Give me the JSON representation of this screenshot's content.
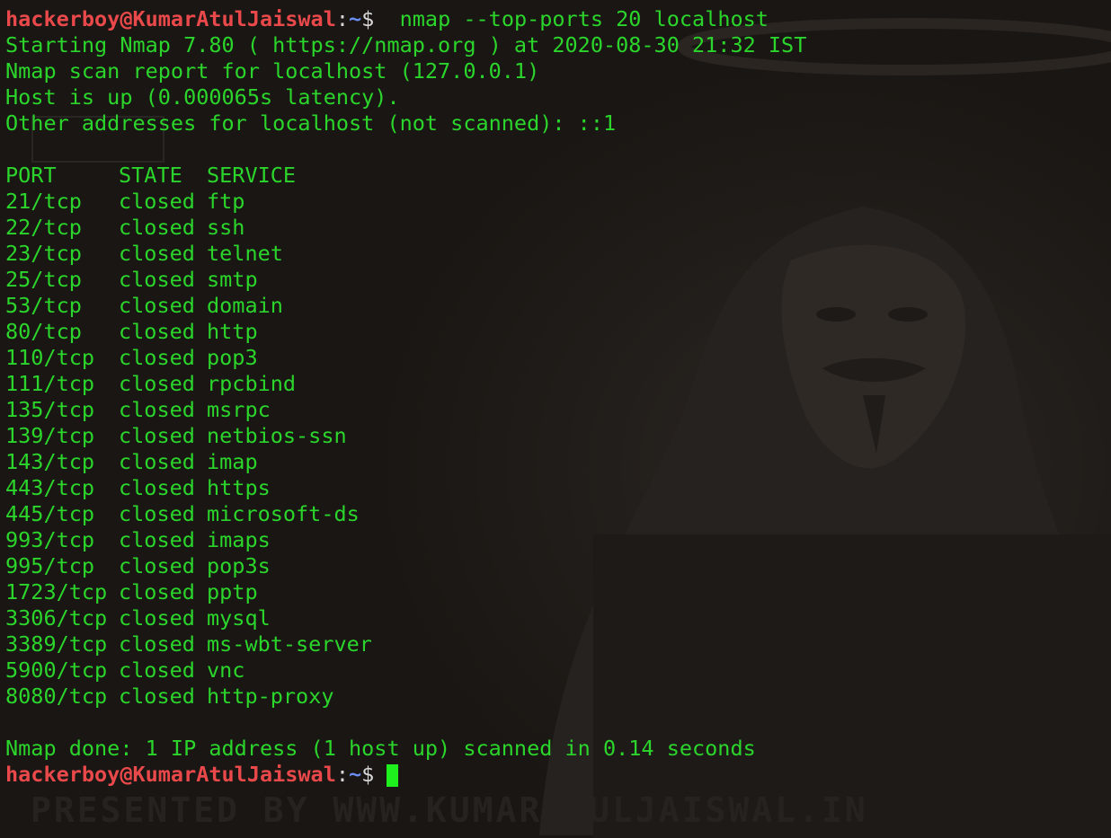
{
  "watermark": "PRESENTED BY WWW.KUMARATULJAISWAL.IN",
  "prompt": {
    "user_host": "hackerboy@KumarAtulJaiswal",
    "separator": ":",
    "path": "~",
    "symbol": "$"
  },
  "command": " nmap --top-ports 20 localhost",
  "header_lines": [
    "Starting Nmap 7.80 ( https://nmap.org ) at 2020-08-30 21:32 IST",
    "Nmap scan report for localhost (127.0.0.1)",
    "Host is up (0.000065s latency).",
    "Other addresses for localhost (not scanned): ::1"
  ],
  "table": {
    "headers": [
      "PORT",
      "STATE",
      "SERVICE"
    ],
    "rows": [
      [
        "21/tcp",
        "closed",
        "ftp"
      ],
      [
        "22/tcp",
        "closed",
        "ssh"
      ],
      [
        "23/tcp",
        "closed",
        "telnet"
      ],
      [
        "25/tcp",
        "closed",
        "smtp"
      ],
      [
        "53/tcp",
        "closed",
        "domain"
      ],
      [
        "80/tcp",
        "closed",
        "http"
      ],
      [
        "110/tcp",
        "closed",
        "pop3"
      ],
      [
        "111/tcp",
        "closed",
        "rpcbind"
      ],
      [
        "135/tcp",
        "closed",
        "msrpc"
      ],
      [
        "139/tcp",
        "closed",
        "netbios-ssn"
      ],
      [
        "143/tcp",
        "closed",
        "imap"
      ],
      [
        "443/tcp",
        "closed",
        "https"
      ],
      [
        "445/tcp",
        "closed",
        "microsoft-ds"
      ],
      [
        "993/tcp",
        "closed",
        "imaps"
      ],
      [
        "995/tcp",
        "closed",
        "pop3s"
      ],
      [
        "1723/tcp",
        "closed",
        "pptp"
      ],
      [
        "3306/tcp",
        "closed",
        "mysql"
      ],
      [
        "3389/tcp",
        "closed",
        "ms-wbt-server"
      ],
      [
        "5900/tcp",
        "closed",
        "vnc"
      ],
      [
        "8080/tcp",
        "closed",
        "http-proxy"
      ]
    ]
  },
  "footer_line": "Nmap done: 1 IP address (1 host up) scanned in 0.14 seconds",
  "colors": {
    "output_text": "#2bd52b",
    "prompt_user": "#e9494a",
    "prompt_path": "#6b8cf0",
    "cursor": "#1ef01e",
    "background": "#1c1916"
  }
}
